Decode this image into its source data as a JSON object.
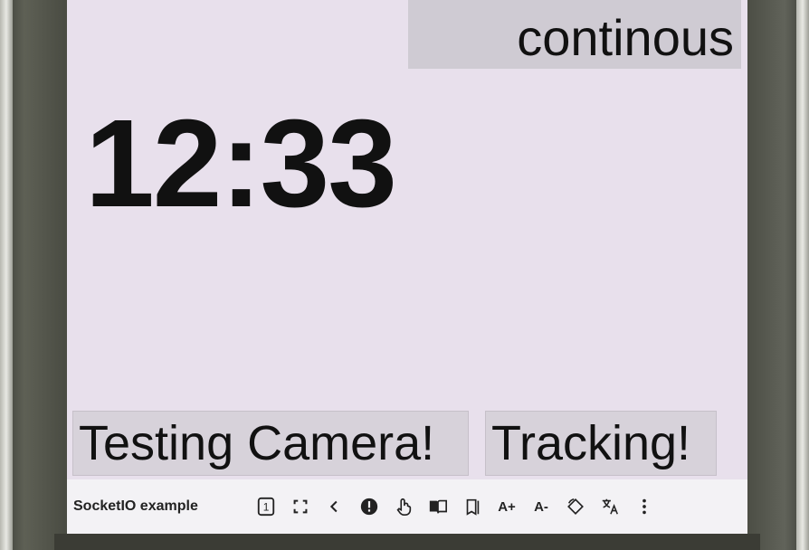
{
  "screen": {
    "mode_label": "continous",
    "clock": "12:33",
    "buttons": {
      "camera_label": "Testing Camera!",
      "tracking_label": "Tracking!"
    }
  },
  "toolbar": {
    "app_title": "SocketIO example",
    "icons": [
      "page-number-icon",
      "fullscreen-icon",
      "back-chevron-icon",
      "alert-icon",
      "touch-icon",
      "reader-icon",
      "bookmark-icon",
      "font-increase-icon",
      "font-decrease-icon",
      "rotate-icon",
      "translate-icon",
      "more-vert-icon"
    ],
    "page_number": "1",
    "font_increase_label": "A+",
    "font_decrease_label": "A-"
  },
  "colors": {
    "screen_bg": "#e8e0ec",
    "mode_box_bg": "#cfcbd3",
    "button_bg": "#d7d2da",
    "toolbar_bg": "#f3f2f5",
    "text": "#111111"
  }
}
